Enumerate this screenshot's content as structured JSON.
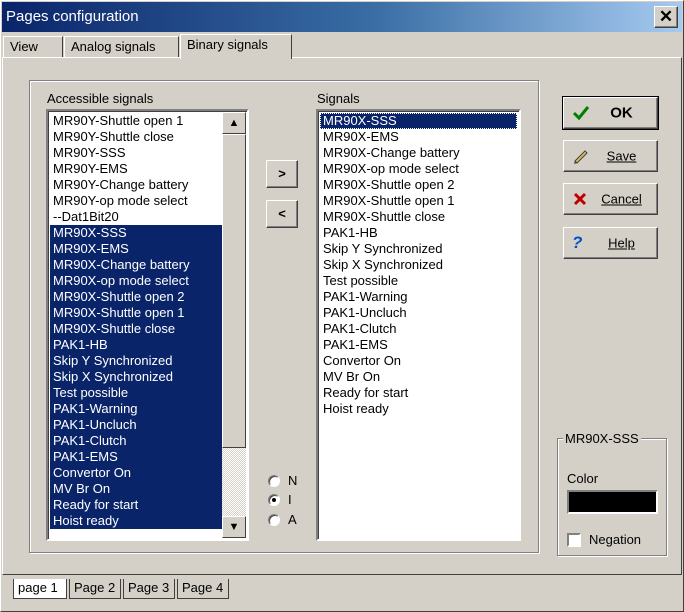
{
  "window": {
    "title": "Pages configuration",
    "close_label": "✕"
  },
  "tabs": [
    {
      "label": "View"
    },
    {
      "label": "Analog signals"
    },
    {
      "label": "Binary signals"
    }
  ],
  "accessible": {
    "label": "Accessible signals",
    "items": [
      {
        "text": "MR90Y-Shuttle open 1",
        "selected": false
      },
      {
        "text": "MR90Y-Shuttle close",
        "selected": false
      },
      {
        "text": "MR90Y-SSS",
        "selected": false
      },
      {
        "text": "MR90Y-EMS",
        "selected": false
      },
      {
        "text": "MR90Y-Change battery",
        "selected": false
      },
      {
        "text": "MR90Y-op mode select",
        "selected": false
      },
      {
        "text": "--Dat1Bit20",
        "selected": false
      },
      {
        "text": "MR90X-SSS",
        "selected": true
      },
      {
        "text": "MR90X-EMS",
        "selected": true
      },
      {
        "text": "MR90X-Change battery",
        "selected": true
      },
      {
        "text": "MR90X-op mode select",
        "selected": true
      },
      {
        "text": "MR90X-Shuttle open 2",
        "selected": true
      },
      {
        "text": "MR90X-Shuttle open 1",
        "selected": true
      },
      {
        "text": "MR90X-Shuttle close",
        "selected": true
      },
      {
        "text": "PAK1-HB",
        "selected": true
      },
      {
        "text": "Skip Y Synchronized",
        "selected": true
      },
      {
        "text": "Skip X Synchronized",
        "selected": true
      },
      {
        "text": "Test possible",
        "selected": true
      },
      {
        "text": "PAK1-Warning",
        "selected": true
      },
      {
        "text": "PAK1-Uncluch",
        "selected": true
      },
      {
        "text": "PAK1-Clutch",
        "selected": true
      },
      {
        "text": "PAK1-EMS",
        "selected": true
      },
      {
        "text": "Convertor On",
        "selected": true
      },
      {
        "text": "MV Br On",
        "selected": true
      },
      {
        "text": "Ready for start",
        "selected": true
      },
      {
        "text": "Hoist ready",
        "selected": true
      }
    ]
  },
  "transfer": {
    "add_label": ">",
    "remove_label": "<"
  },
  "radio": {
    "options": [
      {
        "label": "N",
        "checked": false
      },
      {
        "label": "I",
        "checked": true
      },
      {
        "label": "A",
        "checked": false
      }
    ]
  },
  "signals": {
    "label": "Signals",
    "items": [
      {
        "text": "MR90X-SSS",
        "selected": true
      },
      {
        "text": "MR90X-EMS",
        "selected": false
      },
      {
        "text": "MR90X-Change battery",
        "selected": false
      },
      {
        "text": "MR90X-op mode select",
        "selected": false
      },
      {
        "text": "MR90X-Shuttle open 2",
        "selected": false
      },
      {
        "text": "MR90X-Shuttle open 1",
        "selected": false
      },
      {
        "text": "MR90X-Shuttle close",
        "selected": false
      },
      {
        "text": "PAK1-HB",
        "selected": false
      },
      {
        "text": "Skip Y Synchronized",
        "selected": false
      },
      {
        "text": "Skip X Synchronized",
        "selected": false
      },
      {
        "text": "Test possible",
        "selected": false
      },
      {
        "text": "PAK1-Warning",
        "selected": false
      },
      {
        "text": "PAK1-Uncluch",
        "selected": false
      },
      {
        "text": "PAK1-Clutch",
        "selected": false
      },
      {
        "text": "PAK1-EMS",
        "selected": false
      },
      {
        "text": "Convertor On",
        "selected": false
      },
      {
        "text": "MV Br On",
        "selected": false
      },
      {
        "text": "Ready for start",
        "selected": false
      },
      {
        "text": "Hoist ready",
        "selected": false
      }
    ]
  },
  "buttons": {
    "ok": "OK",
    "save": "Save",
    "cancel": "Cancel",
    "help": "Help"
  },
  "properties": {
    "title": "MR90X-SSS",
    "color_label": "Color",
    "color_value": "#000000",
    "negation_label": "Negation",
    "negation_checked": false
  },
  "pages": [
    {
      "label": "page 1"
    },
    {
      "label": "Page 2"
    },
    {
      "label": "Page 3"
    },
    {
      "label": "Page 4"
    }
  ],
  "colors": {
    "selection": "#0a246a",
    "ok_check": "#008000",
    "cancel_x": "#c00000",
    "help_q": "#0050c8"
  }
}
